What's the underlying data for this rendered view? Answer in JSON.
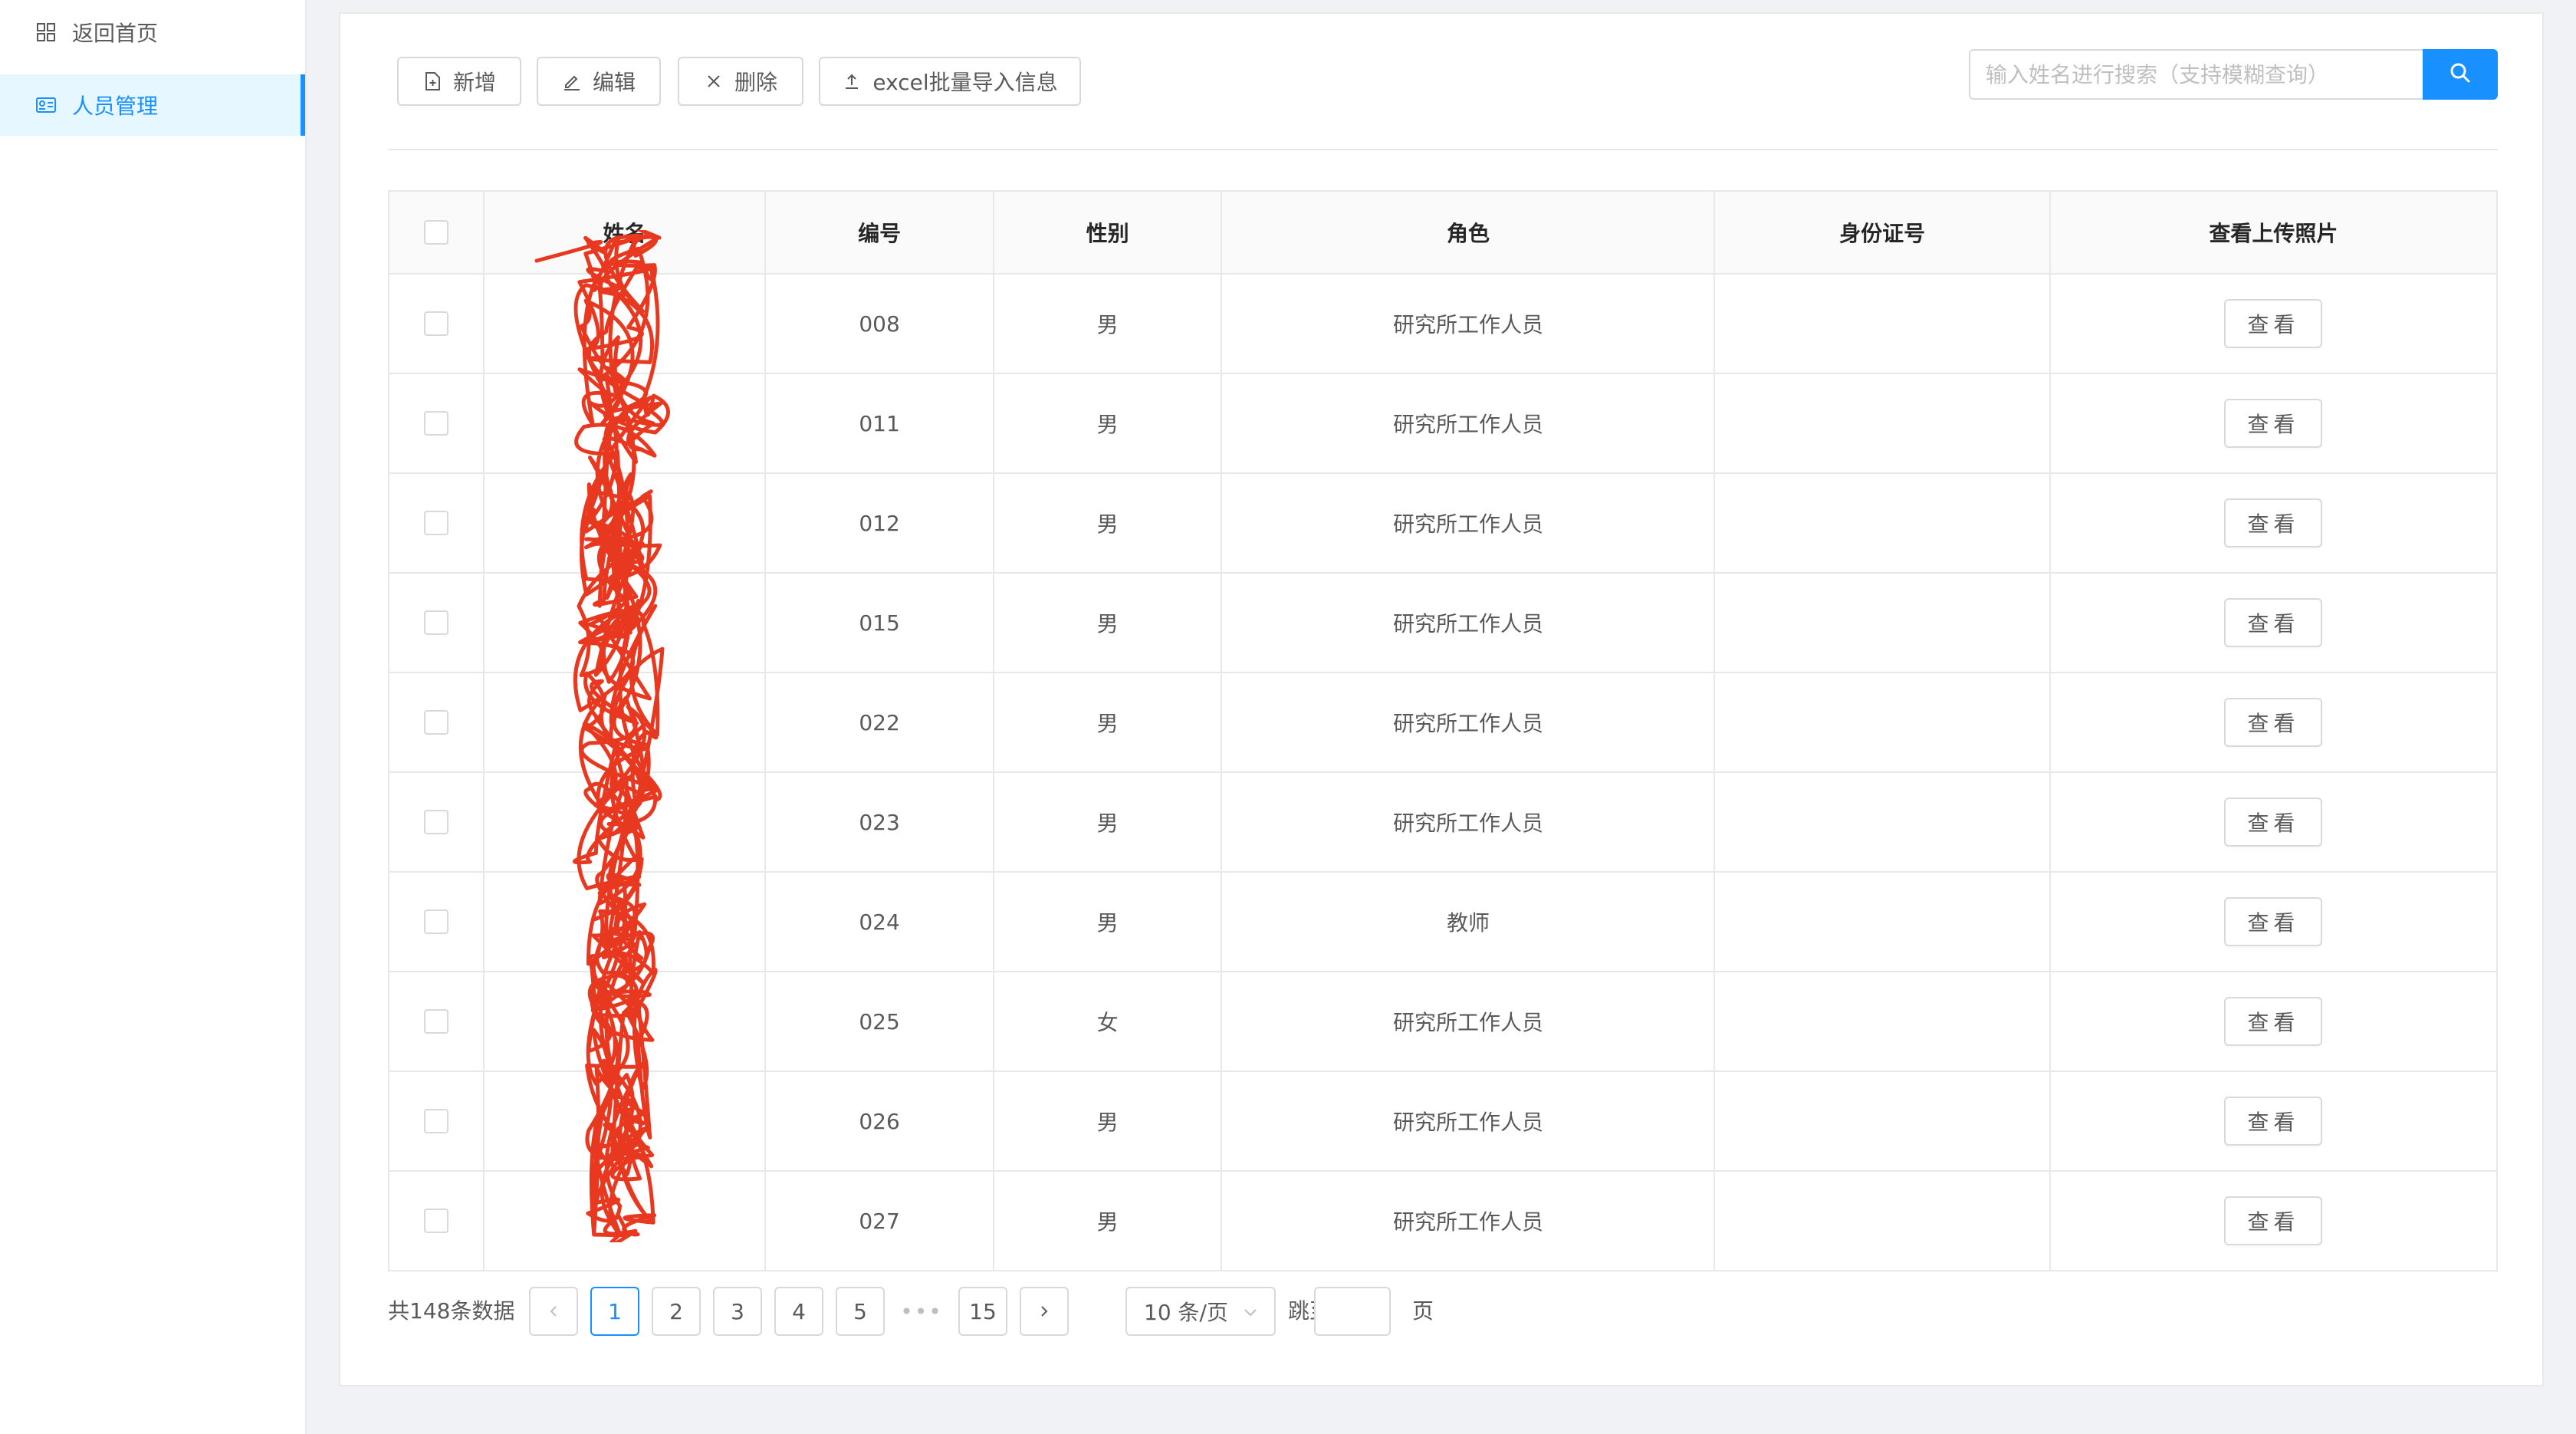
{
  "sidebar": {
    "items": [
      {
        "label": "返回首页",
        "icon": "grid-icon"
      },
      {
        "label": "人员管理",
        "icon": "id-card-icon",
        "active": true
      }
    ]
  },
  "toolbar": {
    "add_label": "新增",
    "edit_label": "编辑",
    "delete_label": "删除",
    "import_label": "excel批量导入信息"
  },
  "search": {
    "placeholder": "输入姓名进行搜索（支持模糊查询）",
    "value": ""
  },
  "table": {
    "headers": [
      "姓名",
      "编号",
      "性别",
      "角色",
      "身份证号",
      "查看上传照片"
    ],
    "view_label": "查看",
    "rows": [
      {
        "name": "",
        "id": "008",
        "gender": "男",
        "role": "研究所工作人员",
        "id_card": ""
      },
      {
        "name": "",
        "id": "011",
        "gender": "男",
        "role": "研究所工作人员",
        "id_card": ""
      },
      {
        "name": "",
        "id": "012",
        "gender": "男",
        "role": "研究所工作人员",
        "id_card": ""
      },
      {
        "name": "",
        "id": "015",
        "gender": "男",
        "role": "研究所工作人员",
        "id_card": ""
      },
      {
        "name": "",
        "id": "022",
        "gender": "男",
        "role": "研究所工作人员",
        "id_card": ""
      },
      {
        "name": "",
        "id": "023",
        "gender": "男",
        "role": "研究所工作人员",
        "id_card": ""
      },
      {
        "name": "",
        "id": "024",
        "gender": "男",
        "role": "教师",
        "id_card": ""
      },
      {
        "name": "",
        "id": "025",
        "gender": "女",
        "role": "研究所工作人员",
        "id_card": ""
      },
      {
        "name": "",
        "id": "026",
        "gender": "男",
        "role": "研究所工作人员",
        "id_card": ""
      },
      {
        "name": "",
        "id": "027",
        "gender": "男",
        "role": "研究所工作人员",
        "id_card": ""
      }
    ]
  },
  "pagination": {
    "total_text": "共148条数据",
    "pages": [
      "1",
      "2",
      "3",
      "4",
      "5"
    ],
    "current": "1",
    "ellipsis": "•••",
    "last_page": "15",
    "page_size": "10 条/页",
    "jump_label": "跳至",
    "jump_suffix": "页",
    "jump_value": ""
  },
  "colors": {
    "primary": "#1890ff",
    "redaction": "#e8381f"
  }
}
